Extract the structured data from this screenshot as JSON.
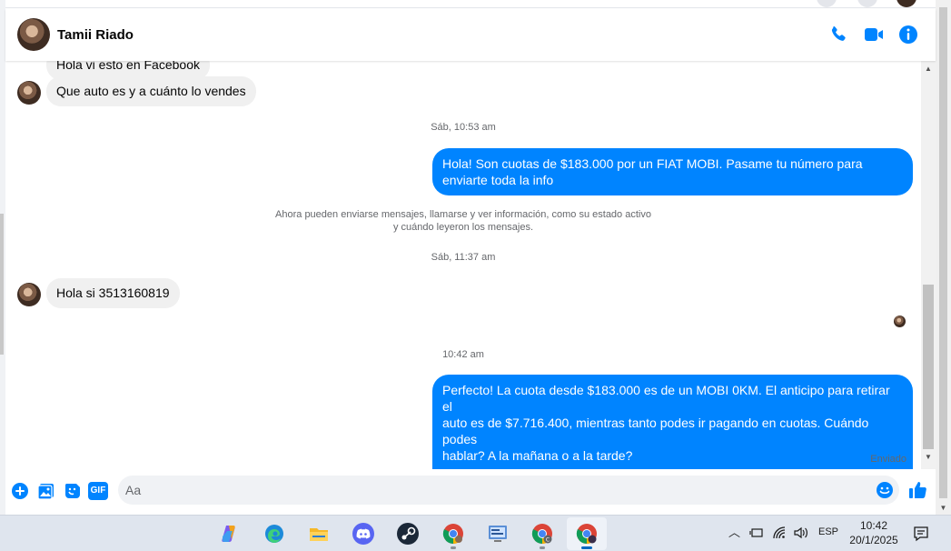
{
  "contact": {
    "name": "Tamii Riado"
  },
  "header_icons": [
    "phone-icon",
    "video-camera-icon",
    "info-icon"
  ],
  "messages": {
    "partial_top": "Hola vi esto en Facebook",
    "incoming_1": "Que auto es y a cuánto lo vendes",
    "ts_1": "Sáb, 10:53 am",
    "outgoing_1": "Hola! Son cuotas de $183.000 por un FIAT MOBI. Pasame tu número para enviarte toda la info",
    "system_line_1": "Ahora pueden enviarse mensajes, llamarse y ver información, como su estado activo",
    "system_line_2": "y cuándo leyeron los mensajes.",
    "ts_2": "Sáb, 11:37 am",
    "incoming_2": "Hola si 3513160819",
    "ts_3": "10:42 am",
    "outgoing_2_line_1": "Perfecto! La cuota desde $183.000 es de un MOBI 0KM. El anticipo para retirar el",
    "outgoing_2_line_2": "auto es de $7.716.400, mientras tanto podes ir pagando en cuotas. Cuándo podes",
    "outgoing_2_line_3": "hablar? A la mañana o a la tarde?",
    "outgoing_2_line_4": ".",
    "status": "Enviado"
  },
  "composer": {
    "placeholder": "Aa",
    "icons": [
      "plus-icon",
      "image-icon",
      "sticker-icon",
      "gif-icon",
      "emoji-icon",
      "like-icon"
    ],
    "gif_label": "GIF"
  },
  "taskbar": {
    "apps": [
      "copilot-icon",
      "edge-icon",
      "file-explorer-icon",
      "discord-icon",
      "steam-icon",
      "chrome-icon",
      "control-panel-icon",
      "chrome-profile-c-icon",
      "chrome-profile-icon"
    ],
    "language": "ESP",
    "time": "10:42",
    "date": "20/1/2025"
  },
  "colors": {
    "accent": "#0084ff",
    "incoming_bubble": "#f0f0f0",
    "muted_text": "#65676b"
  }
}
